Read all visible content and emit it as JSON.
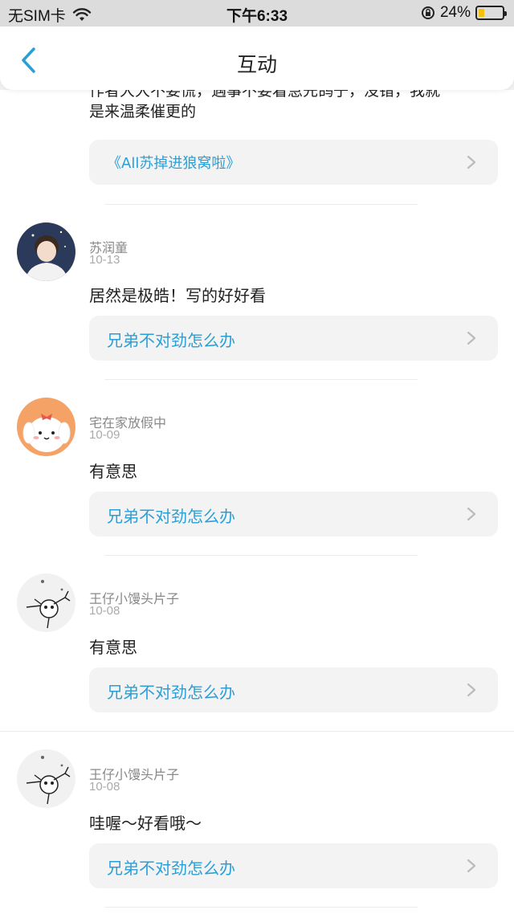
{
  "status_bar": {
    "carrier": "无SIM卡",
    "time": "下午6:33",
    "battery": "24%",
    "battery_level": 0.24
  },
  "header": {
    "title": "互动"
  },
  "top_comment": {
    "text_line1": "作者大大不要慌，遇事不要着急先鸽子，没错，我就",
    "text_line2": "是来温柔催更的",
    "link": "《All苏掉进狼窝啦》"
  },
  "comments": [
    {
      "username": "苏润童",
      "date": "10-13",
      "text": "居然是极皓！写的好好看",
      "link": "兄弟不对劲怎么办"
    },
    {
      "username": "宅在家放假中",
      "date": "10-09",
      "text": "有意思",
      "link": "兄弟不对劲怎么办"
    },
    {
      "username": "王仔小馒头片子",
      "date": "10-08",
      "text": "有意思",
      "link": "兄弟不对劲怎么办"
    },
    {
      "username": "王仔小馒头片子",
      "date": "10-08",
      "text": "哇喔～好看哦～",
      "link": "兄弟不对劲怎么办"
    }
  ],
  "colors": {
    "accent": "#2a9fd6",
    "card_bg": "#f3f3f3"
  },
  "icons": {
    "back": "chevron-left-icon",
    "arrow": "chevron-right-icon",
    "wifi": "wifi-icon",
    "lock": "rotation-lock-icon"
  }
}
